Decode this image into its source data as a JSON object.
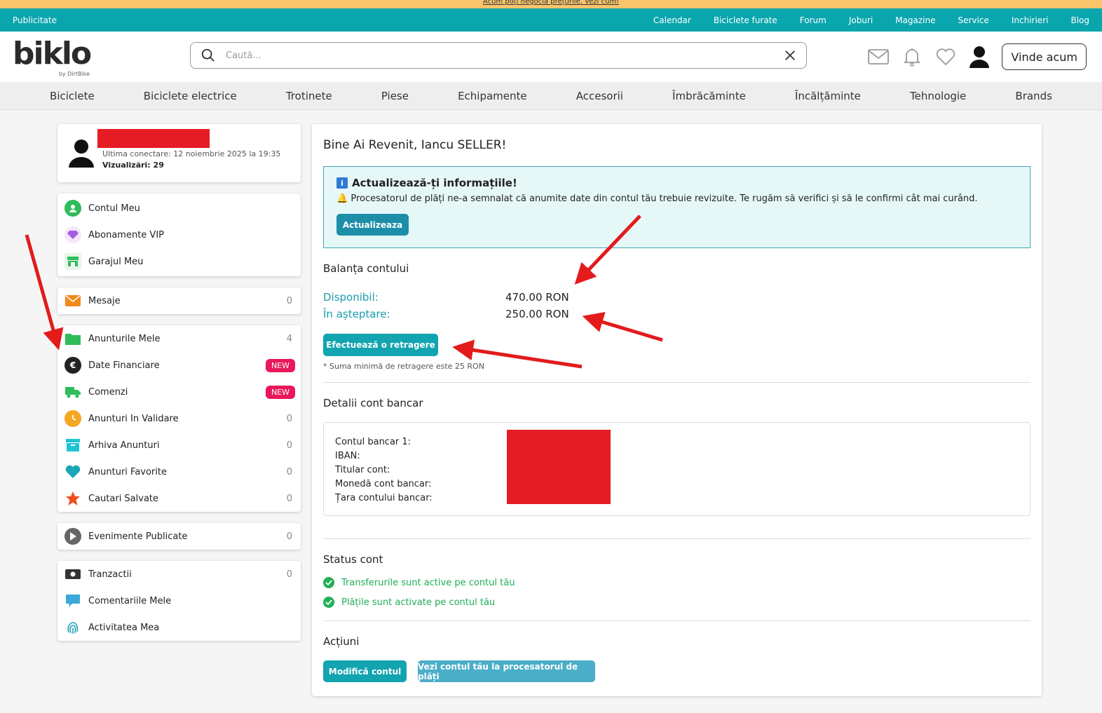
{
  "promo": {
    "text": "Acum poți negocia prețurile. Vezi cum!"
  },
  "topbar": {
    "left": "Publicitate",
    "links": [
      "Calendar",
      "Biciclete furate",
      "Forum",
      "Joburi",
      "Magazine",
      "Service",
      "Inchirieri",
      "Blog"
    ]
  },
  "header": {
    "logo": "biklo",
    "logo_by": "by DirtBike",
    "search_placeholder": "Caută...",
    "sell_button": "Vinde acum"
  },
  "categories": [
    "Biciclete",
    "Biciclete electrice",
    "Trotinete",
    "Piese",
    "Echipamente",
    "Accesorii",
    "Îmbrăcăminte",
    "Încălțăminte",
    "Tehnologie",
    "Brands"
  ],
  "profile": {
    "last_login": "Ultima conectare: 12 noiembrie 2025 la 19:35",
    "views": "Vizualizări: 29"
  },
  "sidebar": {
    "group1": [
      {
        "label": "Contul Meu",
        "icon": "user-icon",
        "color": "#2ebd59"
      },
      {
        "label": "Abonamente VIP",
        "icon": "diamond-icon",
        "color": "#a35ee0"
      },
      {
        "label": "Garajul Meu",
        "icon": "garage-icon",
        "color": "#2ebd59"
      }
    ],
    "group2": [
      {
        "label": "Mesaje",
        "icon": "mail-icon",
        "color": "#f28a1c",
        "count": "0"
      }
    ],
    "group3": [
      {
        "label": "Anunturile Mele",
        "icon": "folder-icon",
        "color": "#2ebd59",
        "count": "4"
      },
      {
        "label": "Date Financiare",
        "icon": "euro-icon",
        "color": "#222222",
        "badge": "NEW"
      },
      {
        "label": "Comenzi",
        "icon": "truck-icon",
        "color": "#2ebd59",
        "badge": "NEW"
      },
      {
        "label": "Anunturi In Validare",
        "icon": "clock-icon",
        "color": "#f5a623",
        "count": "0"
      },
      {
        "label": "Arhiva Anunturi",
        "icon": "archive-icon",
        "color": "#1fc4d4",
        "count": "0"
      },
      {
        "label": "Anunturi Favorite",
        "icon": "heart-icon",
        "color": "#1aa6b4",
        "count": "0"
      },
      {
        "label": "Cautari Salvate",
        "icon": "star-icon",
        "color": "#f04c1c",
        "count": "0"
      }
    ],
    "group4": [
      {
        "label": "Evenimente Publicate",
        "icon": "play-icon",
        "color": "#666666",
        "count": "0"
      }
    ],
    "group5": [
      {
        "label": "Tranzactii",
        "icon": "cash-icon",
        "color": "#333333",
        "count": "0"
      },
      {
        "label": "Comentariile Mele",
        "icon": "comment-icon",
        "color": "#3aa8d8"
      },
      {
        "label": "Activitatea Mea",
        "icon": "fingerprint-icon",
        "color": "#1aa6b4"
      }
    ]
  },
  "main": {
    "welcome": "Bine Ai Revenit, Iancu SELLER!",
    "alert_title": "Actualizează-ți informațiile!",
    "alert_message": "Procesatorul de plăți ne-a semnalat că anumite date din contul tău trebuie revizuite. Te rugăm să verifici și să le confirmi cât mai curând.",
    "alert_button": "Actualizeaza",
    "balance_title": "Balanța contului",
    "available_label": "Disponibil:",
    "available_value": "470.00 RON",
    "pending_label": "În așteptare:",
    "pending_value": "250.00 RON",
    "withdraw_button": "Efectuează o retragere",
    "withdraw_note": "* Suma minimă de retragere este 25 RON",
    "bank_title": "Detalii cont bancar",
    "bank_fields": [
      "Contul bancar 1:",
      "IBAN:",
      "Titular cont:",
      "Monedă cont bancar:",
      "Țara contului bancar:"
    ],
    "status_title": "Status cont",
    "status_items": [
      "Transferurile sunt active pe contul tău",
      "Plățile sunt activate pe contul tău"
    ],
    "actions_title": "Acțiuni",
    "modify_button": "Modifică contul",
    "processor_button": "Vezi contul tău la procesatorul de plăți"
  }
}
